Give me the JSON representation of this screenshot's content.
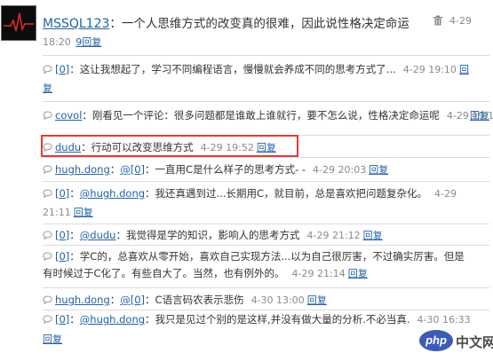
{
  "post": {
    "username": "MSSQL123",
    "colon": "：",
    "text": "一个人思维方式的改变真的很难，因此说性格决定命运",
    "date": "4-29",
    "time": "18:20",
    "reply_label": "9回复"
  },
  "comments": [
    {
      "user": "[0]",
      "prefix": "",
      "text": "：这让我想起了，学习不同编程语言，慢慢就会养成不同的思考方式了...",
      "meta": "4-29 19:10",
      "reply_label": "回",
      "line2_reply": "复"
    },
    {
      "user": "covol",
      "prefix": "",
      "text": "：刚看见一个评论：很多问题都是谁敢上谁就行，要不怎么说，性格决定命运呢",
      "meta": "4-29 19:11",
      "reply_label": "",
      "line2_reply": "回复"
    },
    {
      "user": "dudu",
      "prefix": "",
      "text": "：行动可以改变思维方式",
      "meta": "4-29 19:52",
      "reply_label": "回复",
      "line2_reply": ""
    },
    {
      "user": "hugh.dong",
      "prefix": "@[0]",
      "text": "：一直用C是什么样子的思考方式- -",
      "meta": "4-29 20:03",
      "reply_label": "回复",
      "line2_reply": ""
    },
    {
      "user": "[0]",
      "prefix": "@hugh.dong",
      "text": "：我还真遇到过...长期用C，就目前，总是喜欢把问题复杂化。",
      "meta": "4-29",
      "line2_meta": "21:11",
      "reply_label": "",
      "line2_reply": "回复"
    },
    {
      "user": "[0]",
      "prefix": "@dudu",
      "text": "：我觉得是学的知识，影响人的思考方式",
      "meta": "4-29 21:12",
      "reply_label": "回复",
      "line2_reply": ""
    },
    {
      "user": "[0]",
      "prefix": "",
      "text": "：学C的，总喜欢从零开始，喜欢自己实现方法...以为自己很厉害，不过确实厉害。但是",
      "line2_text": "有时候过于C化了。有些自大了。当然，也有例外的。",
      "meta": "4-29 21:14",
      "reply_label": "",
      "line2_reply": "回复"
    },
    {
      "user": "hugh.dong",
      "prefix": "@[0]",
      "text": "：C语言码农表示悲伤",
      "meta": "4-30 13:00",
      "reply_label": "回复",
      "line2_reply": ""
    },
    {
      "user": "[0]",
      "prefix": "@hugh.dong",
      "text": "：我只是见过个别的是这样,并没有做大量的分析.不必当真.",
      "meta": "4-30 16:33",
      "reply_label": "",
      "line2_reply": "回复"
    }
  ],
  "watermark": {
    "logo": "php",
    "text": "中文网"
  },
  "colors": {
    "link": "#2361a5",
    "highlight": "#e53935",
    "meta": "#8a8a8a"
  }
}
